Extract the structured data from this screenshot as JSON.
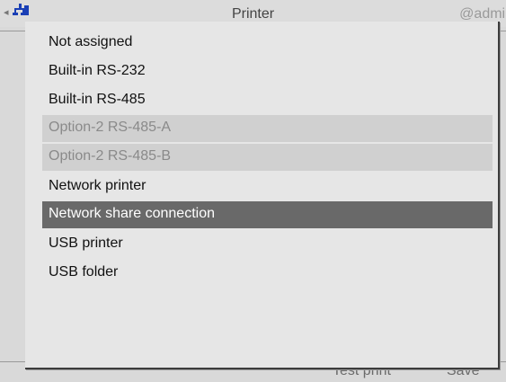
{
  "header": {
    "title": "Printer",
    "user": "@admin",
    "nav_icon": "left-arrow-icon",
    "network_icon": "network-icon"
  },
  "footer": {
    "test_print_label": "Test print",
    "save_label": "Save"
  },
  "menu": {
    "items": [
      {
        "label": "Not assigned",
        "state": "normal"
      },
      {
        "label": "Built-in RS-232",
        "state": "normal"
      },
      {
        "label": "Built-in RS-485",
        "state": "normal"
      },
      {
        "label": "Option-2 RS-485-A",
        "state": "disabled"
      },
      {
        "label": "Option-2 RS-485-B",
        "state": "disabled"
      },
      {
        "label": "Network printer",
        "state": "normal"
      },
      {
        "label": "Network share connection",
        "state": "selected"
      },
      {
        "label": "USB printer",
        "state": "normal"
      },
      {
        "label": "USB folder",
        "state": "normal"
      }
    ]
  },
  "colors": {
    "selected_bg": "#696969",
    "disabled_bg": "#d0d0d0",
    "dialog_bg": "#e6e6e6",
    "network_icon_blue": "#1a3fb5"
  }
}
